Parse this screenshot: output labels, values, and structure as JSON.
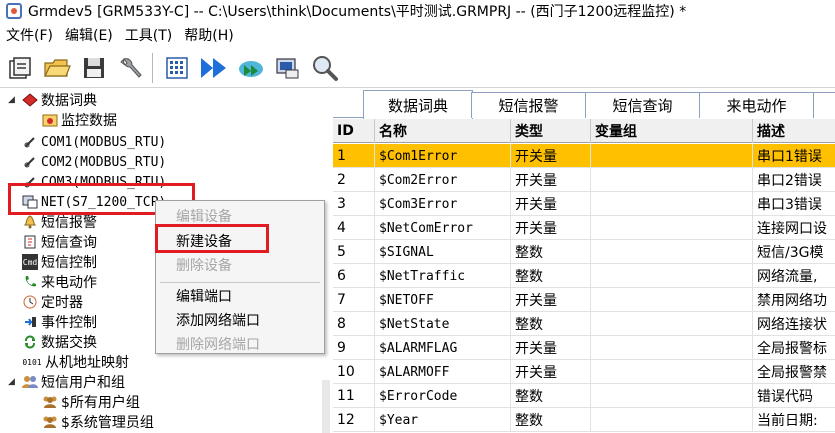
{
  "window": {
    "title": "Grmdev5 [GRM533Y-C]  -- C:\\Users\\think\\Documents\\平时测试.GRMPRJ -- (西门子1200远程监控) *"
  },
  "menu": [
    "文件(F)",
    "编辑(E)",
    "工具(T)",
    "帮助(H)"
  ],
  "toolbar": {
    "icons": [
      "new-project-icon",
      "open-folder-icon",
      "save-icon",
      "settings-wrench-icon",
      "grid-config-icon",
      "fast-forward-icon",
      "cloud-sync-icon",
      "device-monitor-icon",
      "search-magnifier-icon"
    ]
  },
  "tree": {
    "items": [
      {
        "label": "数据词典",
        "icon": "book-icon"
      },
      {
        "label": "监控数据",
        "icon": "monitor-data-icon"
      },
      {
        "label": "COM1(MODBUS_RTU)",
        "icon": "serial-port-icon"
      },
      {
        "label": "COM2(MODBUS_RTU)",
        "icon": "serial-port-icon"
      },
      {
        "label": "COM3(MODBUS_RTU)",
        "icon": "serial-port-icon"
      },
      {
        "label": "NET(S7_1200_TCP)",
        "icon": "network-port-icon"
      },
      {
        "label": "短信报警",
        "icon": "bell-icon"
      },
      {
        "label": "短信查询",
        "icon": "query-icon"
      },
      {
        "label": "短信控制",
        "icon": "sms-control-icon"
      },
      {
        "label": "来电动作",
        "icon": "phone-icon"
      },
      {
        "label": "定时器",
        "icon": "timer-icon"
      },
      {
        "label": "事件控制",
        "icon": "event-icon"
      },
      {
        "label": "数据交换",
        "icon": "exchange-icon"
      },
      {
        "label": "从机地址映射",
        "icon": "address-map-icon"
      },
      {
        "label": "短信用户和组",
        "icon": "users-icon"
      },
      {
        "label": "$所有用户组",
        "icon": "group-icon"
      },
      {
        "label": "$系统管理员组",
        "icon": "group-icon"
      }
    ],
    "badge_0101": "0101",
    "badge_cmd": "Cmd"
  },
  "context_menu": {
    "items": [
      {
        "label": "编辑设备",
        "enabled": false
      },
      {
        "label": "新建设备",
        "enabled": true
      },
      {
        "label": "删除设备",
        "enabled": false
      },
      {
        "label": "编辑端口",
        "enabled": true
      },
      {
        "label": "添加网络端口",
        "enabled": true
      },
      {
        "label": "删除网络端口",
        "enabled": false
      }
    ]
  },
  "tabs": [
    "数据词典",
    "短信报警",
    "短信查询",
    "来电动作"
  ],
  "grid": {
    "columns": [
      "ID",
      "名称",
      "类型",
      "变量组",
      "描述"
    ],
    "rows": [
      {
        "id": "1",
        "name": "$Com1Error",
        "type": "开关量",
        "group": "",
        "desc": "串口1错误"
      },
      {
        "id": "2",
        "name": "$Com2Error",
        "type": "开关量",
        "group": "",
        "desc": "串口2错误"
      },
      {
        "id": "3",
        "name": "$Com3Error",
        "type": "开关量",
        "group": "",
        "desc": "串口3错误"
      },
      {
        "id": "4",
        "name": "$NetComError",
        "type": "开关量",
        "group": "",
        "desc": "连接网口设"
      },
      {
        "id": "5",
        "name": "$SIGNAL",
        "type": "整数",
        "group": "",
        "desc": "短信/3G模"
      },
      {
        "id": "6",
        "name": "$NetTraffic",
        "type": "整数",
        "group": "",
        "desc": "网络流量,"
      },
      {
        "id": "7",
        "name": "$NETOFF",
        "type": "开关量",
        "group": "",
        "desc": "禁用网络功"
      },
      {
        "id": "8",
        "name": "$NetState",
        "type": "整数",
        "group": "",
        "desc": "网络连接状"
      },
      {
        "id": "9",
        "name": "$ALARMFLAG",
        "type": "开关量",
        "group": "",
        "desc": "全局报警标"
      },
      {
        "id": "10",
        "name": "$ALARMOFF",
        "type": "开关量",
        "group": "",
        "desc": "全局报警禁"
      },
      {
        "id": "11",
        "name": "$ErrorCode",
        "type": "整数",
        "group": "",
        "desc": "错误代码"
      },
      {
        "id": "12",
        "name": "$Year",
        "type": "整数",
        "group": "",
        "desc": "当前日期:"
      }
    ],
    "selected_row": 0
  },
  "colors": {
    "selected_row": "#ffc000",
    "highlight_box": "#e11b22"
  }
}
